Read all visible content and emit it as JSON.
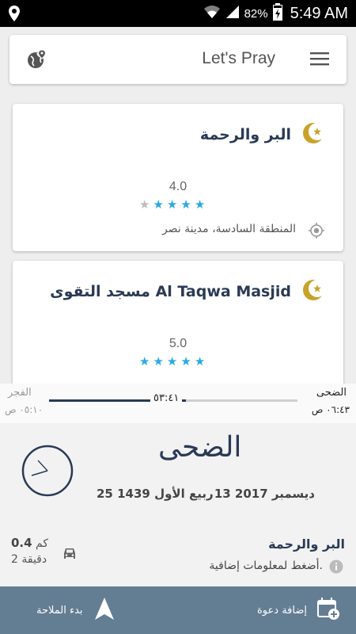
{
  "status_bar": {
    "battery_percent": "82%",
    "time": "5:49 AM",
    "icons": [
      "location-icon",
      "wifi-icon",
      "signal-icon",
      "battery-charging-icon"
    ]
  },
  "header": {
    "title": "Let's Pray",
    "left_icon": "globe-pin-icon",
    "right_icon": "menu-icon"
  },
  "mosques": [
    {
      "name": "البر والرحمة",
      "rating": "4.0",
      "stars_filled": 4,
      "stars_total": 5,
      "address": "المنطقة السادسة، مدينة نصر"
    },
    {
      "name": "مسجد التقوى Al Taqwa Masjid",
      "rating": "5.0",
      "stars_filled": 5,
      "stars_total": 5,
      "address": ""
    }
  ],
  "prayer_panel": {
    "previous_prayer": "الفجر",
    "previous_time": "٠٥:١٠ ص",
    "next_prayer": "الضحى",
    "next_time": "٠٦:٤٣ ص",
    "time_remaining": "٥٣:٤١",
    "progress_fraction": 0.55,
    "current_prayer": "الضحى",
    "gregorian_date": "13 ديسمبر 2017",
    "hijri_date": "25 ربيع الأول 1439"
  },
  "nearest_mosque": {
    "name": "البر والرحمة",
    "hint": "أضغط لمعلومات إضافية.",
    "distance_value": "0.4",
    "distance_unit": "كم",
    "duration": "2 دقيقة"
  },
  "actions": {
    "add_invite": "إضافة دعوة",
    "start_navigation": "بدء الملاحة"
  },
  "colors": {
    "accent_blue": "#29a9e8",
    "dark_navy": "#2a3a55",
    "bottom_bar": "#637d93",
    "crescent_gold": "#c9a227"
  }
}
